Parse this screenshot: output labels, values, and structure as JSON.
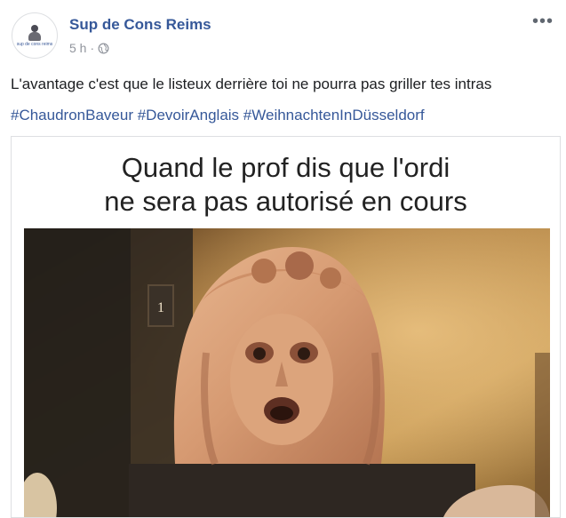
{
  "post": {
    "page_name": "Sup de Cons Reims",
    "timestamp": "5 h",
    "separator": "·",
    "avatar_text": "sup de cons reims",
    "more_label": "•••",
    "text": "L'avantage c'est que le listeux derrière toi ne pourra pas griller tes intras",
    "hashtags": [
      "#ChaudronBaveur",
      "#DevoirAnglais",
      "#WeihnachtenInDüsseldorf"
    ]
  },
  "meme": {
    "caption_line1": "Quand le prof dis que l'ordi",
    "caption_line2": "ne sera pas autorisé en cours",
    "display_number": "1"
  },
  "icons": {
    "audience": "globe-icon",
    "more": "more-options-icon"
  },
  "colors": {
    "link": "#365899",
    "meta": "#90949c",
    "text": "#1c1e21",
    "border": "#dddfe2"
  }
}
